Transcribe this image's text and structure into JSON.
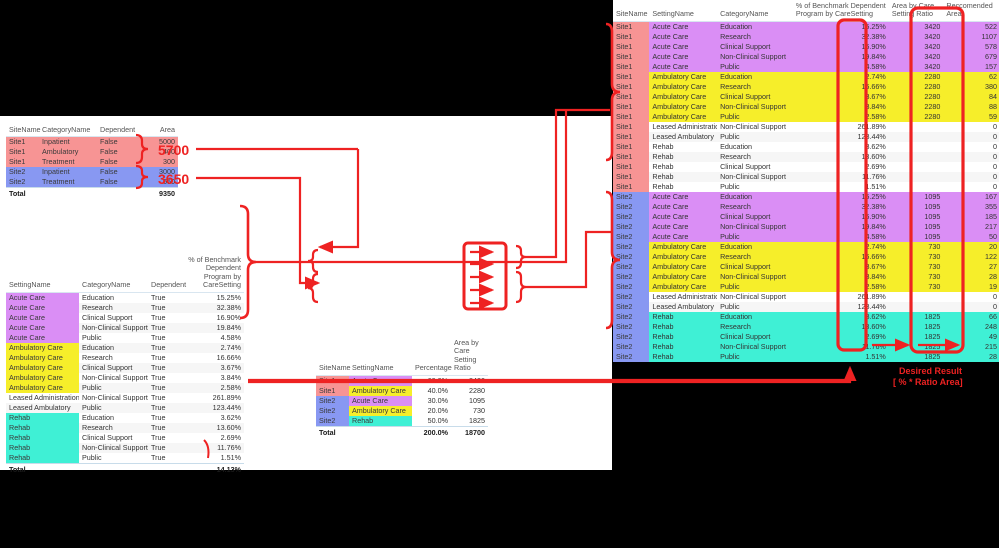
{
  "panels": {
    "left_title": "left-white-panel",
    "right_title": "right-white-panel"
  },
  "area_table": {
    "name": "site-area-table",
    "headers": [
      "SiteName",
      "CategoryName",
      "Dependent",
      "Area"
    ],
    "rows": [
      {
        "site": "Site1",
        "category": "Inpatient",
        "dependent": "False",
        "area": "5000",
        "site_color": "site1"
      },
      {
        "site": "Site1",
        "category": "Ambulatory",
        "dependent": "False",
        "area": "400",
        "site_color": "site1"
      },
      {
        "site": "Site1",
        "category": "Treatment",
        "dependent": "False",
        "area": "300",
        "site_color": "site1"
      },
      {
        "site": "Site2",
        "category": "Inpatient",
        "dependent": "False",
        "area": "3000",
        "site_color": "site2"
      },
      {
        "site": "Site2",
        "category": "Treatment",
        "dependent": "False",
        "area": "650",
        "site_color": "site2"
      }
    ],
    "total_label": "Total",
    "total_area": "9350"
  },
  "benchmark_table": {
    "name": "benchmark-percent-table",
    "headers": [
      "SettingName",
      "CategoryName",
      "Dependent",
      "% of Benchmark Dependent Program by CareSetting"
    ],
    "rows": [
      {
        "setting": "Acute Care",
        "category": "Education",
        "dependent": "True",
        "pct": "15.25%",
        "setting_color": "acute"
      },
      {
        "setting": "Acute Care",
        "category": "Research",
        "dependent": "True",
        "pct": "32.38%",
        "setting_color": "acute"
      },
      {
        "setting": "Acute Care",
        "category": "Clinical Support",
        "dependent": "True",
        "pct": "16.90%",
        "setting_color": "acute"
      },
      {
        "setting": "Acute Care",
        "category": "Non-Clinical Support",
        "dependent": "True",
        "pct": "19.84%",
        "setting_color": "acute"
      },
      {
        "setting": "Acute Care",
        "category": "Public",
        "dependent": "True",
        "pct": "4.58%",
        "setting_color": "acute"
      },
      {
        "setting": "Ambulatory Care",
        "category": "Education",
        "dependent": "True",
        "pct": "2.74%",
        "setting_color": "amb"
      },
      {
        "setting": "Ambulatory Care",
        "category": "Research",
        "dependent": "True",
        "pct": "16.66%",
        "setting_color": "amb"
      },
      {
        "setting": "Ambulatory Care",
        "category": "Clinical Support",
        "dependent": "True",
        "pct": "3.67%",
        "setting_color": "amb"
      },
      {
        "setting": "Ambulatory Care",
        "category": "Non-Clinical Support",
        "dependent": "True",
        "pct": "3.84%",
        "setting_color": "amb"
      },
      {
        "setting": "Ambulatory Care",
        "category": "Public",
        "dependent": "True",
        "pct": "2.58%",
        "setting_color": "amb"
      },
      {
        "setting": "Leased Administration",
        "category": "Non-Clinical Support",
        "dependent": "True",
        "pct": "261.89%",
        "setting_color": "none"
      },
      {
        "setting": "Leased Ambulatory",
        "category": "Public",
        "dependent": "True",
        "pct": "123.44%",
        "setting_color": "none"
      },
      {
        "setting": "Rehab",
        "category": "Education",
        "dependent": "True",
        "pct": "3.62%",
        "setting_color": "rehab"
      },
      {
        "setting": "Rehab",
        "category": "Research",
        "dependent": "True",
        "pct": "13.60%",
        "setting_color": "rehab"
      },
      {
        "setting": "Rehab",
        "category": "Clinical Support",
        "dependent": "True",
        "pct": "2.69%",
        "setting_color": "rehab"
      },
      {
        "setting": "Rehab",
        "category": "Non-Clinical Support",
        "dependent": "True",
        "pct": "11.76%",
        "setting_color": "rehab"
      },
      {
        "setting": "Rehab",
        "category": "Public",
        "dependent": "True",
        "pct": "1.51%",
        "setting_color": "rehab"
      }
    ],
    "total_label": "Total",
    "total_pct": "14.13%"
  },
  "percentage_table": {
    "name": "site-setting-percentage-table",
    "headers": [
      "SiteName",
      "SettingName",
      "Percentage",
      "Area by Care Setting Ratio"
    ],
    "rows": [
      {
        "site": "Site1",
        "setting": "Acute Care",
        "pct": "60.0%",
        "ratio": "3420",
        "site_color": "site1",
        "setting_color": "acute"
      },
      {
        "site": "Site1",
        "setting": "Ambulatory Care",
        "pct": "40.0%",
        "ratio": "2280",
        "site_color": "site1",
        "setting_color": "amb"
      },
      {
        "site": "Site2",
        "setting": "Acute Care",
        "pct": "30.0%",
        "ratio": "1095",
        "site_color": "site2",
        "setting_color": "acute"
      },
      {
        "site": "Site2",
        "setting": "Ambulatory Care",
        "pct": "20.0%",
        "ratio": "730",
        "site_color": "site2",
        "setting_color": "amb"
      },
      {
        "site": "Site2",
        "setting": "Rehab",
        "pct": "50.0%",
        "ratio": "1825",
        "site_color": "site2",
        "setting_color": "rehab"
      }
    ],
    "total_label": "Total",
    "total_pct": "200.0%",
    "total_ratio": "18700"
  },
  "main_table": {
    "name": "recommended-area-table",
    "headers": [
      "SiteName",
      "SettingName",
      "CategoryName",
      "% of Benchmark Dependent Program by CareSetting",
      "Area by Care Setting Ratio",
      "Reccomended Area"
    ],
    "rows": [
      {
        "site": "Site1",
        "setting": "Acute Care",
        "category": "Education",
        "pct": "15.25%",
        "ratio": "3420",
        "rec": "522",
        "site_color": "site1",
        "row_color": "purple"
      },
      {
        "site": "Site1",
        "setting": "Acute Care",
        "category": "Research",
        "pct": "32.38%",
        "ratio": "3420",
        "rec": "1107",
        "site_color": "site1",
        "row_color": "purple"
      },
      {
        "site": "Site1",
        "setting": "Acute Care",
        "category": "Clinical Support",
        "pct": "16.90%",
        "ratio": "3420",
        "rec": "578",
        "site_color": "site1",
        "row_color": "purple"
      },
      {
        "site": "Site1",
        "setting": "Acute Care",
        "category": "Non-Clinical Support",
        "pct": "19.84%",
        "ratio": "3420",
        "rec": "679",
        "site_color": "site1",
        "row_color": "purple"
      },
      {
        "site": "Site1",
        "setting": "Acute Care",
        "category": "Public",
        "pct": "4.58%",
        "ratio": "3420",
        "rec": "157",
        "site_color": "site1",
        "row_color": "purple"
      },
      {
        "site": "Site1",
        "setting": "Ambulatory Care",
        "category": "Education",
        "pct": "2.74%",
        "ratio": "2280",
        "rec": "62",
        "site_color": "site1",
        "row_color": "yellow"
      },
      {
        "site": "Site1",
        "setting": "Ambulatory Care",
        "category": "Research",
        "pct": "16.66%",
        "ratio": "2280",
        "rec": "380",
        "site_color": "site1",
        "row_color": "yellow"
      },
      {
        "site": "Site1",
        "setting": "Ambulatory Care",
        "category": "Clinical Support",
        "pct": "3.67%",
        "ratio": "2280",
        "rec": "84",
        "site_color": "site1",
        "row_color": "yellow"
      },
      {
        "site": "Site1",
        "setting": "Ambulatory Care",
        "category": "Non-Clinical Support",
        "pct": "3.84%",
        "ratio": "2280",
        "rec": "88",
        "site_color": "site1",
        "row_color": "yellow"
      },
      {
        "site": "Site1",
        "setting": "Ambulatory Care",
        "category": "Public",
        "pct": "2.58%",
        "ratio": "2280",
        "rec": "59",
        "site_color": "site1",
        "row_color": "yellow"
      },
      {
        "site": "Site1",
        "setting": "Leased Administration",
        "category": "Non-Clinical Support",
        "pct": "261.89%",
        "ratio": "",
        "rec": "0",
        "site_color": "site1",
        "row_color": "white"
      },
      {
        "site": "Site1",
        "setting": "Leased Ambulatory",
        "category": "Public",
        "pct": "123.44%",
        "ratio": "",
        "rec": "0",
        "site_color": "site1",
        "row_color": "zgray"
      },
      {
        "site": "Site1",
        "setting": "Rehab",
        "category": "Education",
        "pct": "3.62%",
        "ratio": "",
        "rec": "0",
        "site_color": "site1",
        "row_color": "white"
      },
      {
        "site": "Site1",
        "setting": "Rehab",
        "category": "Research",
        "pct": "13.60%",
        "ratio": "",
        "rec": "0",
        "site_color": "site1",
        "row_color": "zgray"
      },
      {
        "site": "Site1",
        "setting": "Rehab",
        "category": "Clinical Support",
        "pct": "2.69%",
        "ratio": "",
        "rec": "0",
        "site_color": "site1",
        "row_color": "white"
      },
      {
        "site": "Site1",
        "setting": "Rehab",
        "category": "Non-Clinical Support",
        "pct": "11.76%",
        "ratio": "",
        "rec": "0",
        "site_color": "site1",
        "row_color": "zgray"
      },
      {
        "site": "Site1",
        "setting": "Rehab",
        "category": "Public",
        "pct": "1.51%",
        "ratio": "",
        "rec": "0",
        "site_color": "site1",
        "row_color": "white"
      },
      {
        "site": "Site2",
        "setting": "Acute Care",
        "category": "Education",
        "pct": "15.25%",
        "ratio": "1095",
        "rec": "167",
        "site_color": "site2",
        "row_color": "purple"
      },
      {
        "site": "Site2",
        "setting": "Acute Care",
        "category": "Research",
        "pct": "32.38%",
        "ratio": "1095",
        "rec": "355",
        "site_color": "site2",
        "row_color": "purple"
      },
      {
        "site": "Site2",
        "setting": "Acute Care",
        "category": "Clinical Support",
        "pct": "16.90%",
        "ratio": "1095",
        "rec": "185",
        "site_color": "site2",
        "row_color": "purple"
      },
      {
        "site": "Site2",
        "setting": "Acute Care",
        "category": "Non-Clinical Support",
        "pct": "19.84%",
        "ratio": "1095",
        "rec": "217",
        "site_color": "site2",
        "row_color": "purple"
      },
      {
        "site": "Site2",
        "setting": "Acute Care",
        "category": "Public",
        "pct": "4.58%",
        "ratio": "1095",
        "rec": "50",
        "site_color": "site2",
        "row_color": "purple"
      },
      {
        "site": "Site2",
        "setting": "Ambulatory Care",
        "category": "Education",
        "pct": "2.74%",
        "ratio": "730",
        "rec": "20",
        "site_color": "site2",
        "row_color": "yellow"
      },
      {
        "site": "Site2",
        "setting": "Ambulatory Care",
        "category": "Research",
        "pct": "16.66%",
        "ratio": "730",
        "rec": "122",
        "site_color": "site2",
        "row_color": "yellow"
      },
      {
        "site": "Site2",
        "setting": "Ambulatory Care",
        "category": "Clinical Support",
        "pct": "3.67%",
        "ratio": "730",
        "rec": "27",
        "site_color": "site2",
        "row_color": "yellow"
      },
      {
        "site": "Site2",
        "setting": "Ambulatory Care",
        "category": "Non-Clinical Support",
        "pct": "3.84%",
        "ratio": "730",
        "rec": "28",
        "site_color": "site2",
        "row_color": "yellow"
      },
      {
        "site": "Site2",
        "setting": "Ambulatory Care",
        "category": "Public",
        "pct": "2.58%",
        "ratio": "730",
        "rec": "19",
        "site_color": "site2",
        "row_color": "yellow"
      },
      {
        "site": "Site2",
        "setting": "Leased Administration",
        "category": "Non-Clinical Support",
        "pct": "261.89%",
        "ratio": "",
        "rec": "0",
        "site_color": "site2",
        "row_color": "white"
      },
      {
        "site": "Site2",
        "setting": "Leased Ambulatory",
        "category": "Public",
        "pct": "123.44%",
        "ratio": "",
        "rec": "0",
        "site_color": "site2",
        "row_color": "zgray"
      },
      {
        "site": "Site2",
        "setting": "Rehab",
        "category": "Education",
        "pct": "3.62%",
        "ratio": "1825",
        "rec": "66",
        "site_color": "site2",
        "row_color": "cyan"
      },
      {
        "site": "Site2",
        "setting": "Rehab",
        "category": "Research",
        "pct": "13.60%",
        "ratio": "1825",
        "rec": "248",
        "site_color": "site2",
        "row_color": "cyan"
      },
      {
        "site": "Site2",
        "setting": "Rehab",
        "category": "Clinical Support",
        "pct": "2.69%",
        "ratio": "1825",
        "rec": "49",
        "site_color": "site2",
        "row_color": "cyan"
      },
      {
        "site": "Site2",
        "setting": "Rehab",
        "category": "Non-Clinical Support",
        "pct": "11.76%",
        "ratio": "1825",
        "rec": "215",
        "site_color": "site2",
        "row_color": "cyan"
      },
      {
        "site": "Site2",
        "setting": "Rehab",
        "category": "Public",
        "pct": "1.51%",
        "ratio": "1825",
        "rec": "28",
        "site_color": "site2",
        "row_color": "cyan"
      }
    ]
  },
  "annotations": {
    "site1_sum": "5700",
    "site2_sum": "3650",
    "desired_result_line1": "Desired Result",
    "desired_result_line2": "[ % * Ratio Area]",
    "accent_color": "#ee2222"
  },
  "colors": {
    "site1": "#f79494",
    "site2": "#8898f2",
    "acute_care": "#da8ef5",
    "ambulatory_care": "#f6ee2a",
    "rehab": "#3ff0d5",
    "annotation": "#ee2222",
    "background": "#000000",
    "panel": "#ffffff"
  }
}
